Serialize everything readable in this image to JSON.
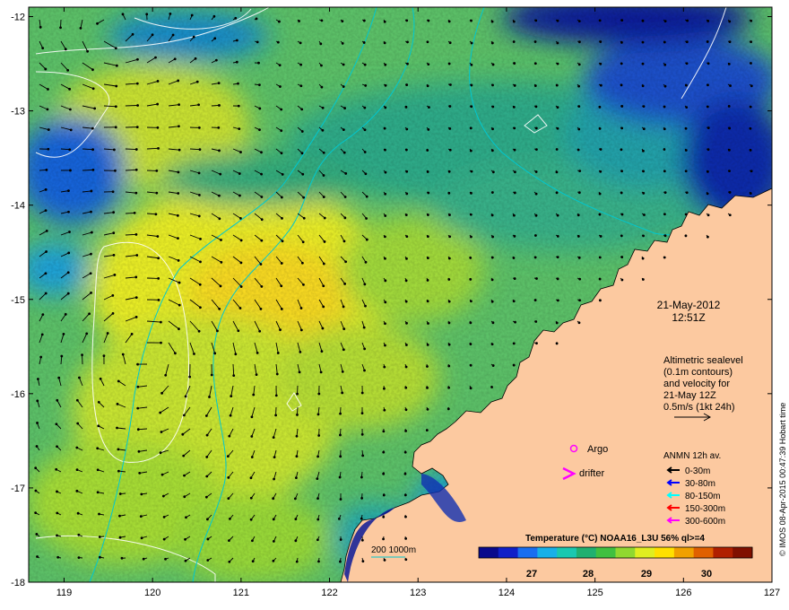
{
  "map": {
    "lon_ticks": [
      "119",
      "120",
      "121",
      "122",
      "123",
      "124",
      "125",
      "126",
      "127"
    ],
    "lat_ticks": [
      "-12",
      "-13",
      "-14",
      "-15",
      "-16",
      "-17",
      "-18"
    ],
    "lon_range": [
      118.6,
      127.0
    ],
    "lat_range": [
      -11.9,
      -18.0
    ]
  },
  "info": {
    "date": "21-May-2012",
    "time": "12:51Z",
    "alt_line1": "Altimetric sealevel",
    "alt_line2": "(0.1m contours)",
    "alt_line3": "and velocity for",
    "alt_line4": "21-May 12Z",
    "alt_line5": "0.5m/s (1kt 24h)"
  },
  "legend": {
    "argo": "Argo",
    "drifter": "drifter",
    "anmn_title": "ANMN 12h av.",
    "depths": [
      {
        "label": "0-30m",
        "color": "#000000"
      },
      {
        "label": "30-80m",
        "color": "#0000ff"
      },
      {
        "label": "80-150m",
        "color": "#00ffff"
      },
      {
        "label": "150-300m",
        "color": "#ff0000"
      },
      {
        "label": "300-600m",
        "color": "#ff00ff"
      }
    ],
    "isobath": "200  1000m",
    "isobath_color": "#00c0c0"
  },
  "colorbar": {
    "title": "Temperature (°C) NOAA16_L3U 56% ql>=4",
    "ticks": [
      "27",
      "28",
      "29",
      "30"
    ],
    "colors": [
      "#0a0a8c",
      "#1020c8",
      "#1a6ef0",
      "#18b0e8",
      "#1ac8b0",
      "#20b070",
      "#40c040",
      "#90d830",
      "#e0ee20",
      "#ffe000",
      "#f0a000",
      "#e06000",
      "#b02000",
      "#801000"
    ]
  },
  "credit": "© IMOS 08-Apr-2015 00:47:39 Hobart time"
}
